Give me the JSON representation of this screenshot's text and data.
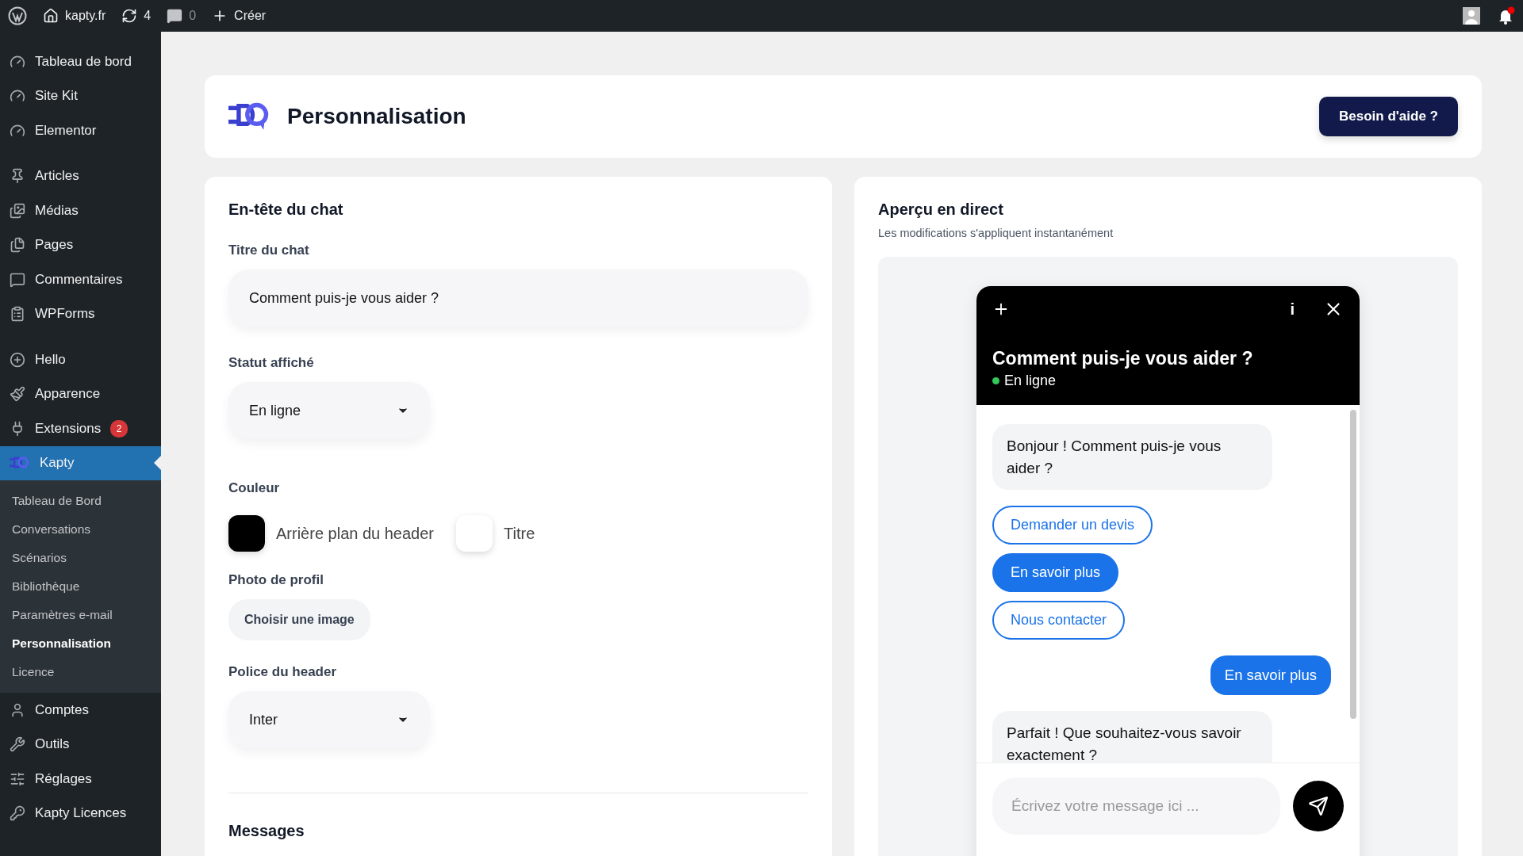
{
  "top_bar": {
    "site": "kapty.fr",
    "updates": "4",
    "comments": "0",
    "create": "Créer"
  },
  "sidebar": {
    "groups": [
      [
        {
          "label": "Tableau de bord",
          "selected": false
        },
        {
          "label": "Site Kit",
          "selected": false
        },
        {
          "label": "Elementor",
          "selected": false
        }
      ],
      [
        {
          "label": "Articles",
          "selected": false
        },
        {
          "label": "Médias",
          "selected": false
        },
        {
          "label": "Pages",
          "selected": false
        },
        {
          "label": "Commentaires",
          "selected": false
        },
        {
          "label": "WPForms",
          "selected": false
        }
      ],
      [
        {
          "label": "Hello",
          "selected": false
        },
        {
          "label": "Apparence",
          "selected": false
        },
        {
          "label": "Extensions",
          "selected": false,
          "badge": "2"
        },
        {
          "label": "Kapty",
          "selected": true,
          "children": [
            {
              "label": "Tableau de Bord",
              "selected": false
            },
            {
              "label": "Conversations",
              "selected": false
            },
            {
              "label": "Scénarios",
              "selected": false
            },
            {
              "label": "Bibliothèque",
              "selected": false
            },
            {
              "label": "Paramètres e-mail",
              "selected": false
            },
            {
              "label": "Personnalisation",
              "selected": true
            },
            {
              "label": "Licence",
              "selected": false
            }
          ]
        },
        {
          "label": "Comptes",
          "selected": false
        },
        {
          "label": "Outils",
          "selected": false
        },
        {
          "label": "Réglages",
          "selected": false
        },
        {
          "label": "Kapty Licences",
          "selected": false
        }
      ]
    ]
  },
  "page_header": {
    "title": "Personnalisation",
    "help_button": "Besoin d'aide ?"
  },
  "settings": {
    "title": "En-tête du chat",
    "chat_title": {
      "label": "Titre du chat",
      "value": "Comment puis-je vous aider ?"
    },
    "status": {
      "label": "Statut affiché",
      "value": "En ligne"
    },
    "colors": {
      "label": "Couleur",
      "items": [
        {
          "label": "Arrière plan du header",
          "color": "#000000"
        },
        {
          "label": "Titre",
          "color": "#ffffff"
        }
      ]
    },
    "photo": {
      "label": "Photo de profil",
      "button": "Choisir une image"
    },
    "font": {
      "label": "Police du header",
      "value": "Inter"
    },
    "next_section": "Messages"
  },
  "preview": {
    "title": "Aperçu en direct",
    "subtitle": "Les modifications s'appliquent instantanément",
    "widget": {
      "info_label": "i",
      "title": "Comment puis-je vous aider ?",
      "status": "En ligne",
      "messages": [
        {
          "kind": "bot",
          "text": "Bonjour ! Comment puis-je vous aider ?"
        },
        {
          "kind": "options",
          "options": [
            {
              "label": "Demander un devis",
              "selected": false
            },
            {
              "label": "En savoir plus",
              "selected": true
            },
            {
              "label": "Nous contacter",
              "selected": false
            }
          ]
        },
        {
          "kind": "user",
          "text": "En savoir plus"
        },
        {
          "kind": "bot",
          "text": "Parfait ! Que souhaitez-vous savoir exactement ?"
        }
      ],
      "input_placeholder": "Écrivez votre message ici ..."
    }
  }
}
